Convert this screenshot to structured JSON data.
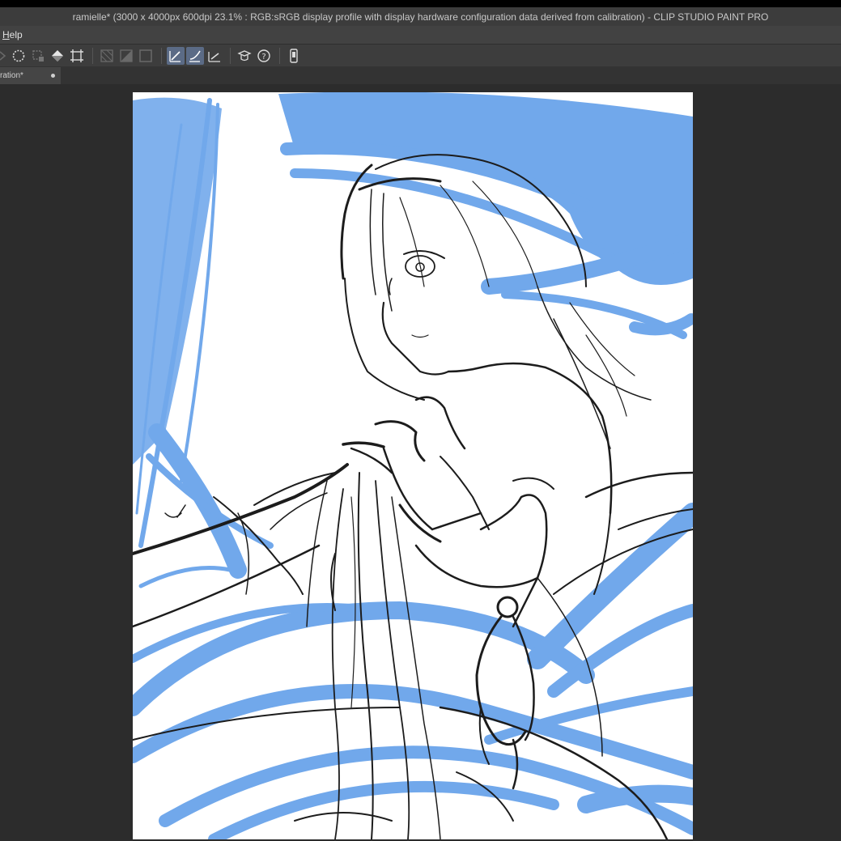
{
  "window": {
    "title": "ramielle* (3000 x 4000px 600dpi 23.1% : RGB:sRGB display profile with display hardware configuration data derived from calibration)  - CLIP STUDIO PAINT PRO"
  },
  "menubar": {
    "help_mnemonic": "H",
    "help_rest": "elp"
  },
  "tabs": [
    {
      "label": "ration*"
    }
  ],
  "colors": {
    "sketch_blue": "#6aa4ea",
    "line_dark": "#1c1c1c",
    "active_tool": "#5b6b86"
  }
}
